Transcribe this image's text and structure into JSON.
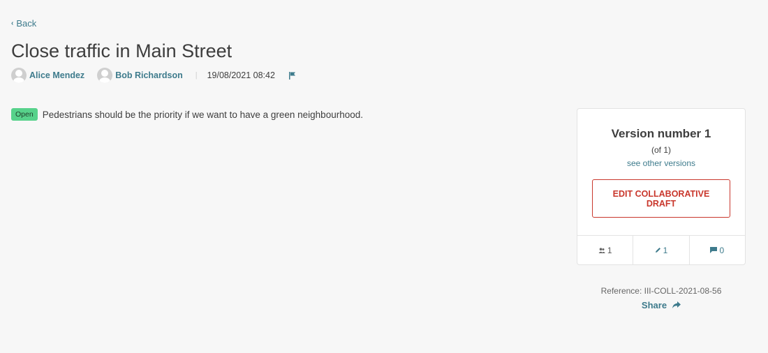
{
  "nav": {
    "back_label": "Back"
  },
  "title": "Close traffic in Main Street",
  "authors": [
    {
      "name": "Alice Mendez"
    },
    {
      "name": "Bob Richardson"
    }
  ],
  "date": "19/08/2021 08:42",
  "status_badge": "Open",
  "status_color": "#57d28b",
  "body": "Pedestrians should be the priority if we want to have a green neighbourhood.",
  "version_card": {
    "title": "Version number 1",
    "of": "(of 1)",
    "see_versions": "see other versions",
    "edit_button": "EDIT COLLABORATIVE DRAFT",
    "stats": [
      {
        "icon": "contributors-icon",
        "value": "1"
      },
      {
        "icon": "pencil-icon",
        "value": "1"
      },
      {
        "icon": "comment-icon",
        "value": "0"
      }
    ]
  },
  "reference": "Reference: III-COLL-2021-08-56",
  "share_label": "Share",
  "colors": {
    "link": "#3e7b8c",
    "danger": "#c9372c"
  }
}
